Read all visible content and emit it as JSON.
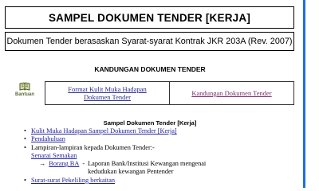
{
  "header": {
    "title": "SAMPEL DOKUMEN TENDER [KERJA]",
    "subtitle": "Dokumen Tender berasaskan Syarat-syarat Kontrak JKR 203A (Rev. 2007)"
  },
  "contents_heading": "KANDUNGAN DOKUMEN TENDER",
  "help": {
    "label": "Bantuan",
    "icon": "help-book-icon"
  },
  "nav": {
    "cover_line1": "Format Kulit Muka Hadapan",
    "cover_line2": "Dokumen Tender",
    "contents": "Kandungan Dokumen Tender"
  },
  "list": {
    "heading": "Sampel Dokumen Tender [Kerja]",
    "items": [
      "Kulit Muka Hadapan Sampel Dokumen Tender [Kerja]",
      "Pendahuluan",
      "Lampiran-lampiran kepada Dokumen Tender:-"
    ],
    "checklist": "Senarai Semakan",
    "form": {
      "arrow": "→",
      "code": "Borang BA",
      "dash": "-",
      "desc_line1": "Laporan Bank/Institusi Kewangan mengenai",
      "desc_line2": "kedudukan kewangan Pentender"
    },
    "last_item": "Surat-surat Pekeliling berkaitan",
    "bullet": "•"
  },
  "colors": {
    "link": "#1f1f9a",
    "visited": "#7a2a6a",
    "rule": "#1d6fe0"
  }
}
